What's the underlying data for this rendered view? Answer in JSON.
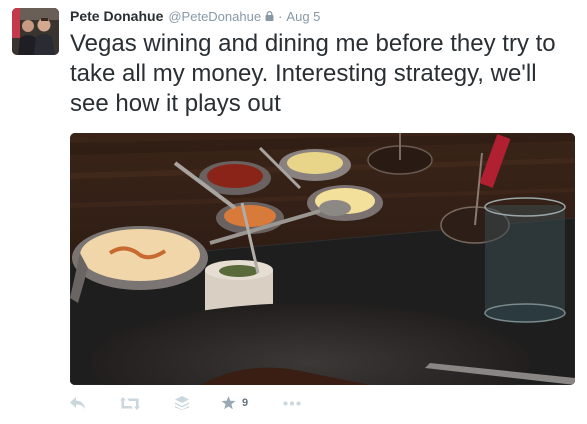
{
  "tweet": {
    "author": {
      "name": "Pete Donahue",
      "handle": "@PeteDonahue",
      "protected_icon": "lock-icon"
    },
    "separator": "·",
    "timestamp": "Aug 5",
    "text": "Vegas wining and dining me before they try to take all my money. Interesting strategy, we'll see how it plays out",
    "media": {
      "type": "photo",
      "icon": "photo"
    },
    "actions": {
      "reply_icon": "reply-icon",
      "retweet_icon": "retweet-icon",
      "stack_icon": "stack-icon",
      "favorite_icon": "star-icon",
      "favorite_count": "9",
      "more_icon": "more-icon"
    },
    "colors": {
      "text": "#292f33",
      "secondary": "#8899a6",
      "action_icon": "#ccd6dd",
      "count": "#66757f"
    }
  }
}
